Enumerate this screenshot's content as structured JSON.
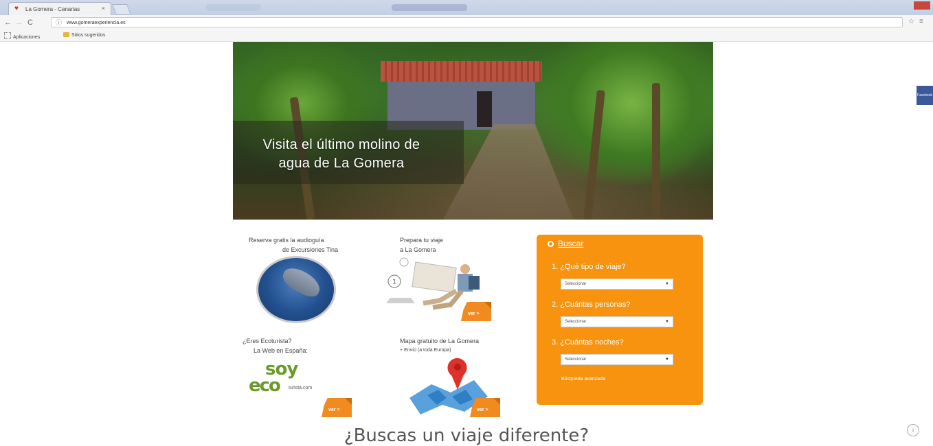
{
  "browser": {
    "tab_title": "La Gomera - Canarias",
    "tab_close": "×",
    "url": "www.gomeraexperiencia.es",
    "bookmarks": [
      "Aplicaciones",
      "Sitios sugeridos"
    ],
    "nav": {
      "back": "←",
      "forward": "→",
      "reload": "C"
    }
  },
  "hero": {
    "caption_line1": "Visita el último molino de",
    "caption_line2": "agua de La Gomera"
  },
  "promos": {
    "audioguide": {
      "line1": "Reserva gratis la audioguía",
      "line2": "de Excursiones Tina"
    },
    "prepare": {
      "line1": "Prepara tu viaje",
      "line2": "a La Gomera",
      "button": "ver >"
    },
    "eco": {
      "line1": "¿Eres Ecoturista?",
      "line2": "La Web en España:",
      "logo_top": "soy",
      "logo_bottom": "eco",
      "logo_small": "turista.com",
      "button": "ver >"
    },
    "map": {
      "line1": "Mapa gratuito de La Gomera",
      "line2": "+ Envío (a toda Europa)",
      "button": "ver >"
    }
  },
  "search": {
    "title": "Buscar",
    "q1": "1. ¿Qué tipo de viaje?",
    "q2": "2. ¿Cuántas personas?",
    "q3": "3. ¿Cuántas noches?",
    "select_placeholder": "Seleccionar",
    "link": "Búsqueda avanzada"
  },
  "facebook_tab": "Facebook",
  "bottom_title": "¿Buscas un viaje diferente?",
  "colors": {
    "accent": "#f7930f",
    "button": "#f28b1f",
    "eco_green": "#6a9b2a"
  },
  "icons": [
    "heart-favicon",
    "info-icon",
    "search-icon",
    "facebook-icon"
  ]
}
